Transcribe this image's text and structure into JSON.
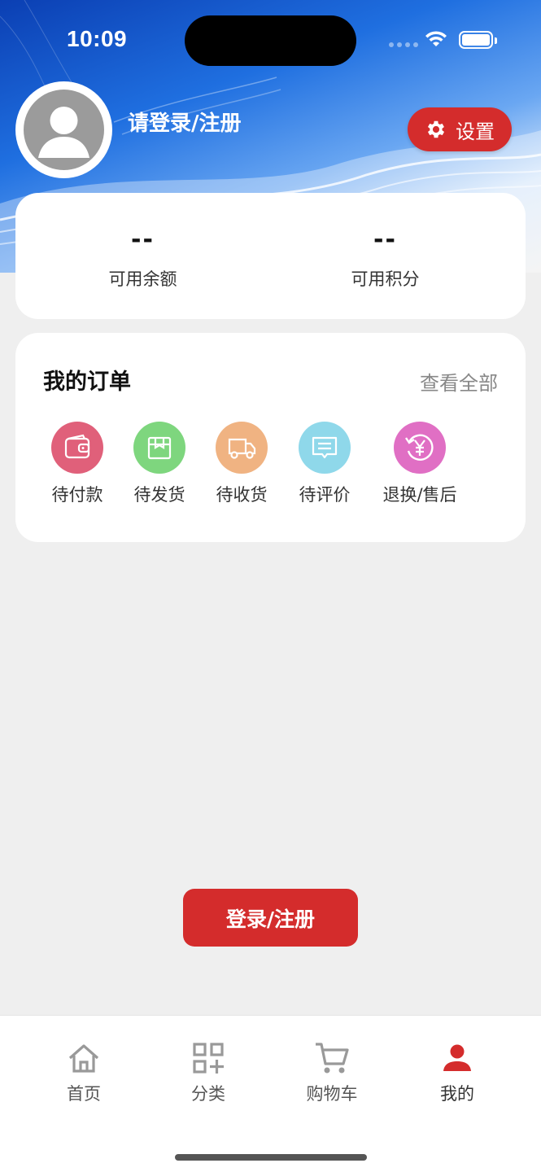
{
  "status_bar": {
    "time": "10:09"
  },
  "header": {
    "login_prompt": "请登录/注册",
    "settings_label": "设置"
  },
  "stats": [
    {
      "value": "--",
      "label": "可用余额"
    },
    {
      "value": "--",
      "label": "可用积分"
    }
  ],
  "orders": {
    "title": "我的订单",
    "view_all": "查看全部",
    "items": [
      {
        "label": "待付款",
        "icon": "wallet-icon",
        "color": "#e0607a"
      },
      {
        "label": "待发货",
        "icon": "package-icon",
        "color": "#7ed67e"
      },
      {
        "label": "待收货",
        "icon": "truck-icon",
        "color": "#f0b382"
      },
      {
        "label": "待评价",
        "icon": "comment-icon",
        "color": "#8fd8ea"
      },
      {
        "label": "退换/售后",
        "icon": "refund-icon",
        "color": "#e06fc4"
      }
    ]
  },
  "login_button": "登录/注册",
  "tabbar": {
    "active_color": "#d42c2c",
    "items": [
      {
        "label": "首页",
        "icon": "home-icon"
      },
      {
        "label": "分类",
        "icon": "category-icon"
      },
      {
        "label": "购物车",
        "icon": "cart-icon"
      },
      {
        "label": "我的",
        "icon": "user-icon",
        "active": true
      }
    ]
  },
  "colors": {
    "accent": "#d42c2c",
    "background": "#efefef"
  }
}
